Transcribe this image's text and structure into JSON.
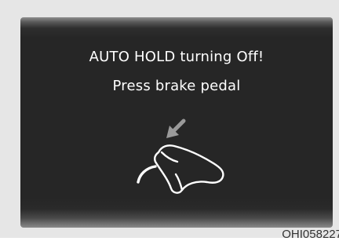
{
  "message": {
    "line1": "AUTO HOLD turning Off!",
    "line2": "Press brake pedal"
  },
  "icon": "brake-pedal-press-icon",
  "caption": "OHI058227",
  "colors": {
    "screen": "#262626",
    "text": "#ffffff",
    "frame": "#e6e6e6",
    "icon_arrow": "#9a9a9a"
  }
}
